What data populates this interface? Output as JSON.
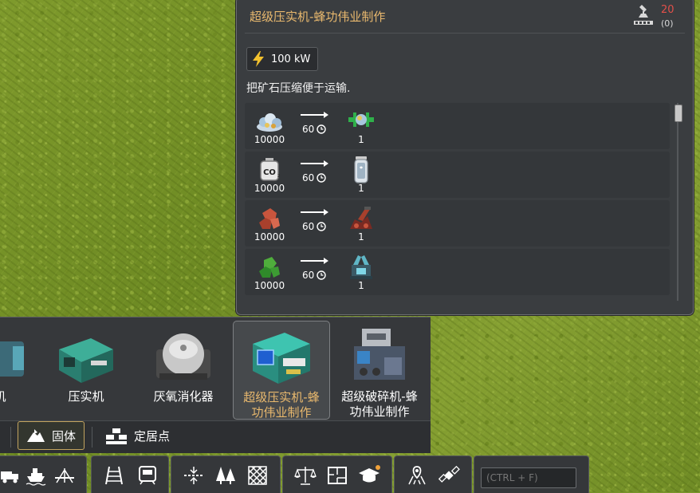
{
  "info_panel": {
    "title": "超级压实机-蜂功伟业制作",
    "count_main": "20",
    "count_sub": "(0)",
    "power": "100 kW",
    "description": "把矿石压缩便于运输.",
    "recipes": [
      {
        "input_qty": "10000",
        "time": "60",
        "output_qty": "1",
        "input_icon": "ore-pile-icon",
        "output_icon": "compressed-block-icon"
      },
      {
        "input_qty": "10000",
        "time": "60",
        "output_qty": "1",
        "input_icon": "co2-tank-icon",
        "output_icon": "gas-canister-icon"
      },
      {
        "input_qty": "10000",
        "time": "60",
        "output_qty": "1",
        "input_icon": "red-ore-icon",
        "output_icon": "red-machine-icon"
      },
      {
        "input_qty": "10000",
        "time": "60",
        "output_qty": "1",
        "input_icon": "green-ore-icon",
        "output_icon": "teal-machine-icon"
      }
    ]
  },
  "build_menu": {
    "items": [
      {
        "label": "机",
        "selected": false
      },
      {
        "label": "压实机",
        "selected": false
      },
      {
        "label": "厌氧消化器",
        "selected": false
      },
      {
        "label": "超级压实机-蜂功伟业制作",
        "label_line1": "超级压实机-蜂",
        "label_line2": "功伟业制作",
        "selected": true
      },
      {
        "label": "超级破碎机-蜂功伟业制作",
        "label_line1": "超级破碎机-蜂",
        "label_line2": "功伟业制作",
        "selected": false
      }
    ]
  },
  "categories": {
    "solid": "固体",
    "settlement": "定居点"
  },
  "search": {
    "placeholder": "(CTRL + F)"
  },
  "colors": {
    "accent": "#e9b96e",
    "count_red": "#e2504a",
    "panel_bg": "#3a3d40"
  }
}
